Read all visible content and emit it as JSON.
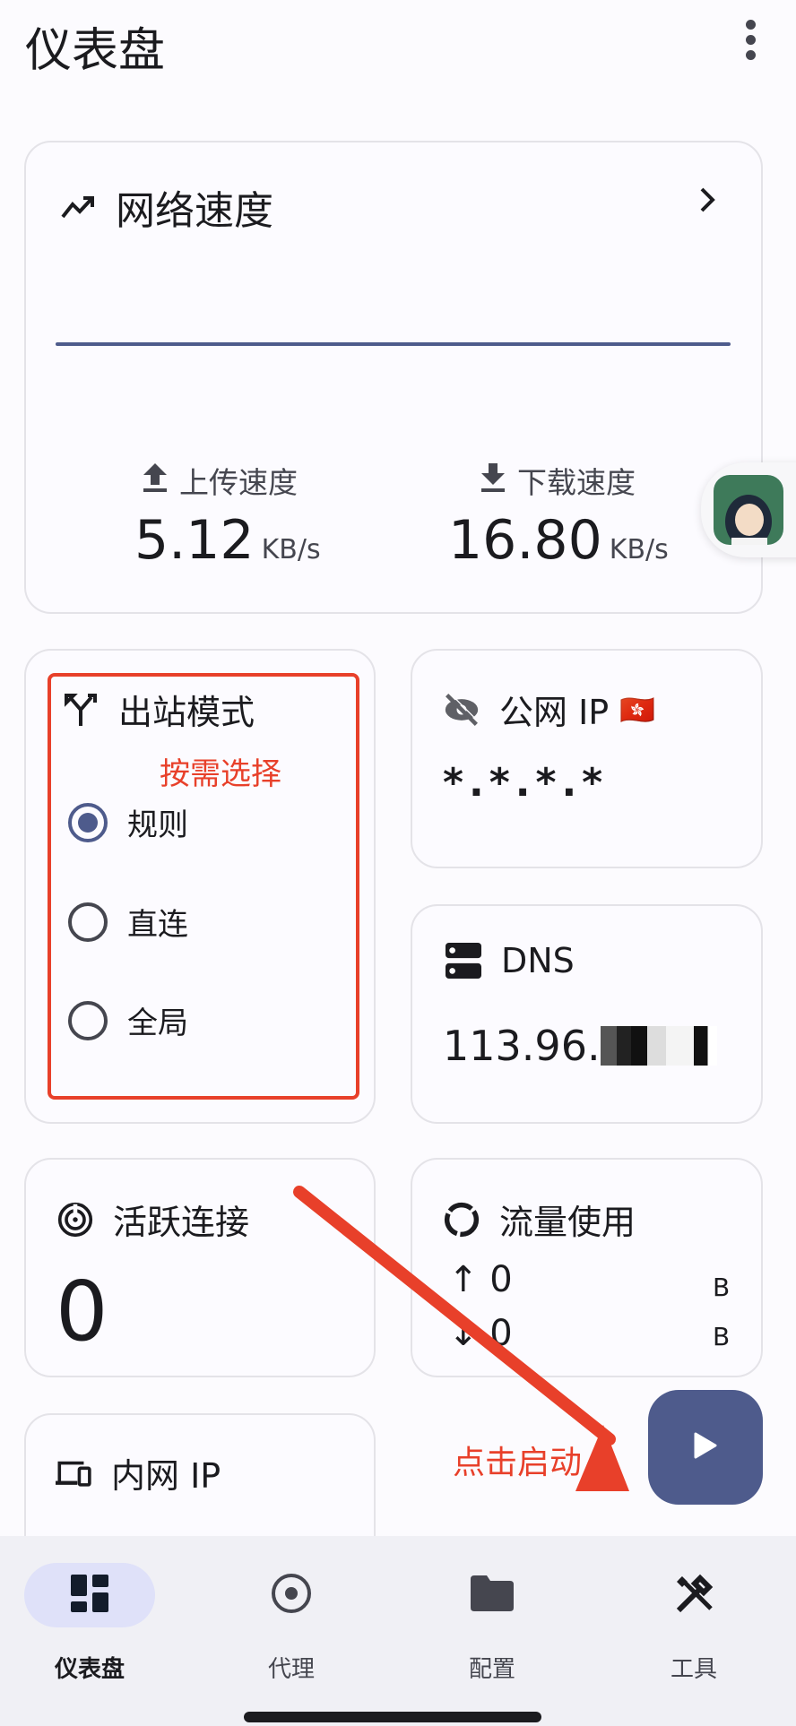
{
  "header": {
    "title": "仪表盘",
    "more_icon": "more-vert-icon"
  },
  "speed_card": {
    "title": "网络速度",
    "upload_label": "上传速度",
    "upload_value": "5.12",
    "upload_unit": "KB/s",
    "download_label": "下载速度",
    "download_value": "16.80",
    "download_unit": "KB/s"
  },
  "outbound": {
    "title": "出站模式",
    "annotation": "按需选择",
    "options": [
      {
        "label": "规则",
        "selected": true
      },
      {
        "label": "直连",
        "selected": false
      },
      {
        "label": "全局",
        "selected": false
      }
    ]
  },
  "public_ip": {
    "title": "公网 IP",
    "flag": "🇭🇰",
    "value": "*.*.*.*"
  },
  "dns": {
    "title": "DNS",
    "value": "113.96."
  },
  "connections": {
    "title": "活跃连接",
    "value": "0"
  },
  "traffic": {
    "title": "流量使用",
    "up_value": "0",
    "up_unit": "B",
    "down_value": "0",
    "down_unit": "B"
  },
  "lan_ip": {
    "title": "内网 IP"
  },
  "start": {
    "annotation": "点击启动",
    "icon": "play-icon"
  },
  "nav": {
    "items": [
      {
        "label": "仪表盘",
        "active": true
      },
      {
        "label": "代理",
        "active": false
      },
      {
        "label": "配置",
        "active": false
      },
      {
        "label": "工具",
        "active": false
      }
    ]
  },
  "colors": {
    "accent": "#4e5b8c",
    "annotation": "#e8402a",
    "active_pill": "#dfe1f9"
  }
}
